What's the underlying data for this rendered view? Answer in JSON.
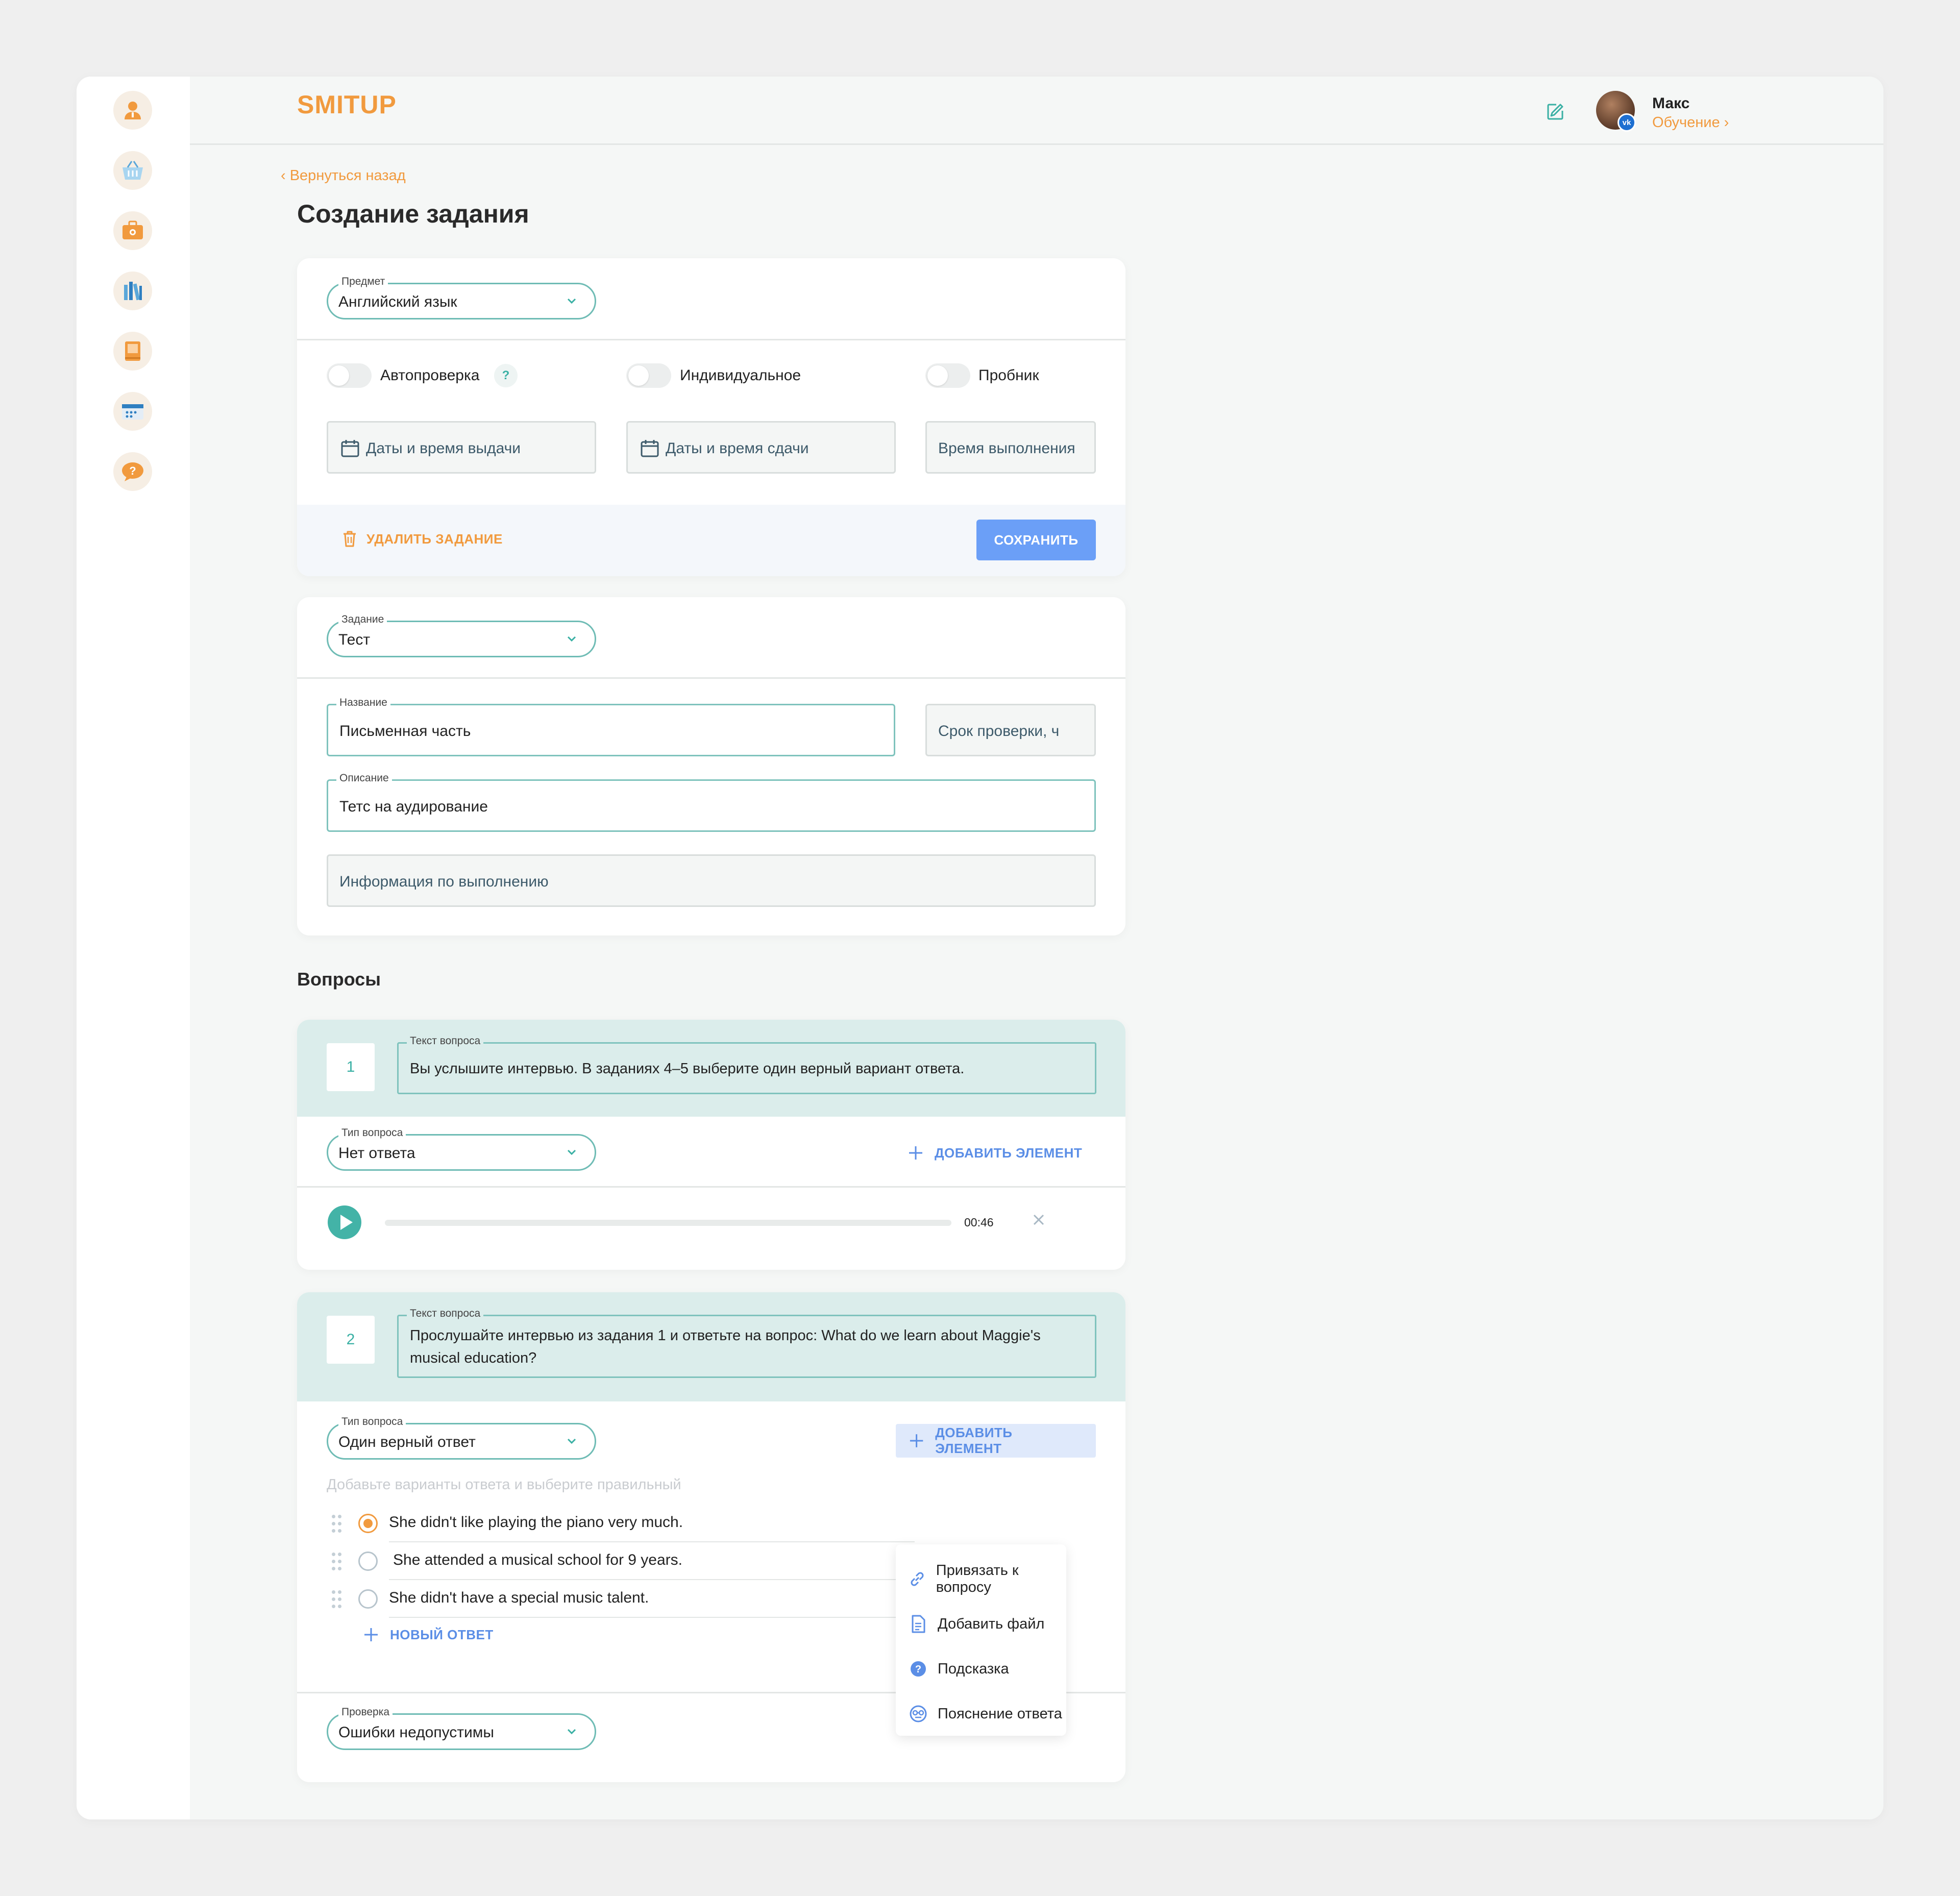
{
  "header": {
    "logo": "SMITUP",
    "user_name": "Макс",
    "user_role": "Обучение ›",
    "vk_badge": "vk"
  },
  "sidebar": {
    "items": [
      {
        "icon": "profile-icon"
      },
      {
        "icon": "basket-icon"
      },
      {
        "icon": "briefcase-icon"
      },
      {
        "icon": "library-icon"
      },
      {
        "icon": "notebook-icon"
      },
      {
        "icon": "calendar-icon"
      },
      {
        "icon": "help-chat-icon"
      }
    ]
  },
  "page": {
    "back_link": "‹  Вернуться назад",
    "title": "Создание задания"
  },
  "settings": {
    "subject_label": "Предмет",
    "subject_value": "Английский язык",
    "toggles": [
      "Автопроверка",
      "Индивидуальное",
      "Пробник"
    ],
    "autocheck_help": "?",
    "issue_dates_placeholder": "Даты и время выдачи",
    "due_dates_placeholder": "Даты и время сдачи",
    "duration_placeholder": "Время выполнения",
    "delete_label": "УДАЛИТЬ ЗАДАНИЕ",
    "save_label": "СОХРАНИТЬ"
  },
  "task": {
    "type_label": "Задание",
    "type_value": "Тест",
    "name_label": "Название",
    "name_value": "Письменная часть",
    "check_term_placeholder": "Срок проверки, ч",
    "description_label": "Описание",
    "description_value": "Тетс на аудирование",
    "info_placeholder": "Информация по выполнению"
  },
  "questions_title": "Вопросы",
  "questions": [
    {
      "number": "1",
      "text_label": "Текст вопроса",
      "text": "Вы услышите интервью. В заданиях 4–5 выберите один верный вариант ответа.",
      "type_label": "Тип вопроса",
      "type_value": "Нет ответа",
      "add_element_label": "ДОБАВИТЬ ЭЛЕМЕНТ",
      "audio_time": "00:46",
      "audio_progress": 0
    },
    {
      "number": "2",
      "text_label": "Текст вопроса",
      "text": "Прослушайте интервью из задания 1 и ответьте на вопрос: What do we learn about Maggie's musical education?",
      "type_label": "Тип вопроса",
      "type_value": "Один верный ответ",
      "add_element_label": "ДОБАВИТЬ ЭЛЕМЕНТ",
      "answers_hint": "Добавьте варианты ответа и выберите правильный",
      "answers": [
        {
          "text": "She didn't like playing the piano very much.",
          "selected": true
        },
        {
          "text": "She attended a musical school for 9 years.",
          "selected": false
        },
        {
          "text": "She didn't have a special music talent.",
          "selected": false
        }
      ],
      "new_answer_label": "НОВЫЙ ОТВЕТ",
      "check_label": "Проверка",
      "check_value": "Ошибки недопустимы"
    }
  ],
  "add_element_menu": {
    "items": [
      {
        "label": "Привязать к вопросу",
        "icon": "link-icon"
      },
      {
        "label": "Добавить файл",
        "icon": "file-icon"
      },
      {
        "label": "Подсказка",
        "icon": "hint-icon"
      },
      {
        "label": "Пояснение ответа",
        "icon": "explanation-icon"
      }
    ]
  },
  "colors": {
    "accent_orange": "#f19a3e",
    "accent_teal": "#43b3a7",
    "accent_blue": "#6b9ff7",
    "question_bg": "#dbedeb"
  }
}
